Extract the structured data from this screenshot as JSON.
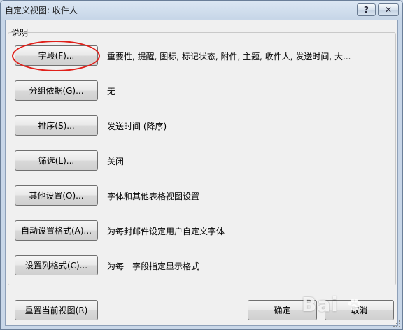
{
  "window": {
    "title": "自定义视图: 收件人",
    "help_label": "?",
    "close_label": "✕"
  },
  "group": {
    "label": "说明"
  },
  "rows": [
    {
      "button": "字段(F)...",
      "desc": "重要性, 提醒, 图标, 标记状态, 附件, 主题, 收件人, 发送时间, 大..."
    },
    {
      "button": "分组依据(G)...",
      "desc": "无"
    },
    {
      "button": "排序(S)...",
      "desc": "发送时间 (降序)"
    },
    {
      "button": "筛选(L)...",
      "desc": "关闭"
    },
    {
      "button": "其他设置(O)...",
      "desc": "字体和其他表格视图设置"
    },
    {
      "button": "自动设置格式(A)...",
      "desc": "为每封邮件设定用户自定义字体"
    },
    {
      "button": "设置列格式(C)...",
      "desc": "为每一字段指定显示格式"
    }
  ],
  "footer": {
    "reset_label": "重置当前视图(R)",
    "ok_label": "确定",
    "cancel_label": "取消"
  },
  "watermark": {
    "text": "Bai"
  },
  "colors": {
    "highlight": "#e0201a",
    "dialog_bg": "#f0f0f0",
    "frame": "#c7d6e8"
  }
}
